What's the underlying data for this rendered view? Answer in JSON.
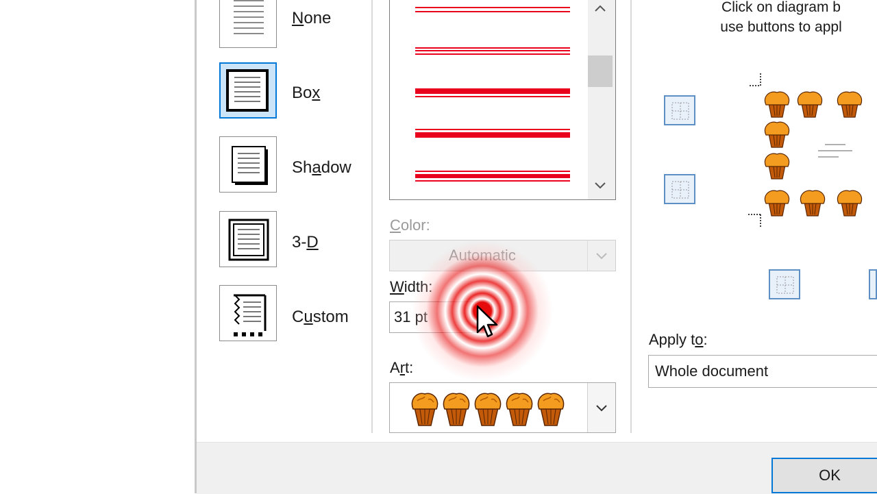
{
  "setting": {
    "items": [
      {
        "name": "None",
        "key": "N",
        "rest": "one",
        "pre": ""
      },
      {
        "name": "Box",
        "key": "x",
        "rest": "",
        "pre": "Bo"
      },
      {
        "name": "Shadow",
        "key": "a",
        "rest": "dow",
        "pre": "Sh"
      },
      {
        "name": "3-D",
        "key": "D",
        "rest": "",
        "pre": "3-"
      },
      {
        "name": "Custom",
        "key": "u",
        "rest": "stom",
        "pre": "C"
      }
    ],
    "selected": "Box"
  },
  "style": {
    "line_color": "#e8001c",
    "scroll_up": "▲",
    "scroll_down": "▼"
  },
  "color": {
    "label_pre": "",
    "label_key": "C",
    "label_rest": "olor:",
    "value": "Automatic",
    "disabled": true
  },
  "width": {
    "label_pre": "",
    "label_key": "W",
    "label_rest": "idth:",
    "value": "31 pt"
  },
  "art": {
    "label_pre": "A",
    "label_key": "r",
    "label_rest": "t:",
    "icon": "muffin-border-art"
  },
  "preview": {
    "instruction_line1": "Click on diagram b",
    "instruction_line2": "use buttons to appl",
    "edge_icon": "border-edge-icon"
  },
  "apply_to": {
    "label_pre": "Apply t",
    "label_key": "o",
    "label_rest": ":",
    "value": "Whole document"
  },
  "buttons": {
    "ok": "OK"
  }
}
